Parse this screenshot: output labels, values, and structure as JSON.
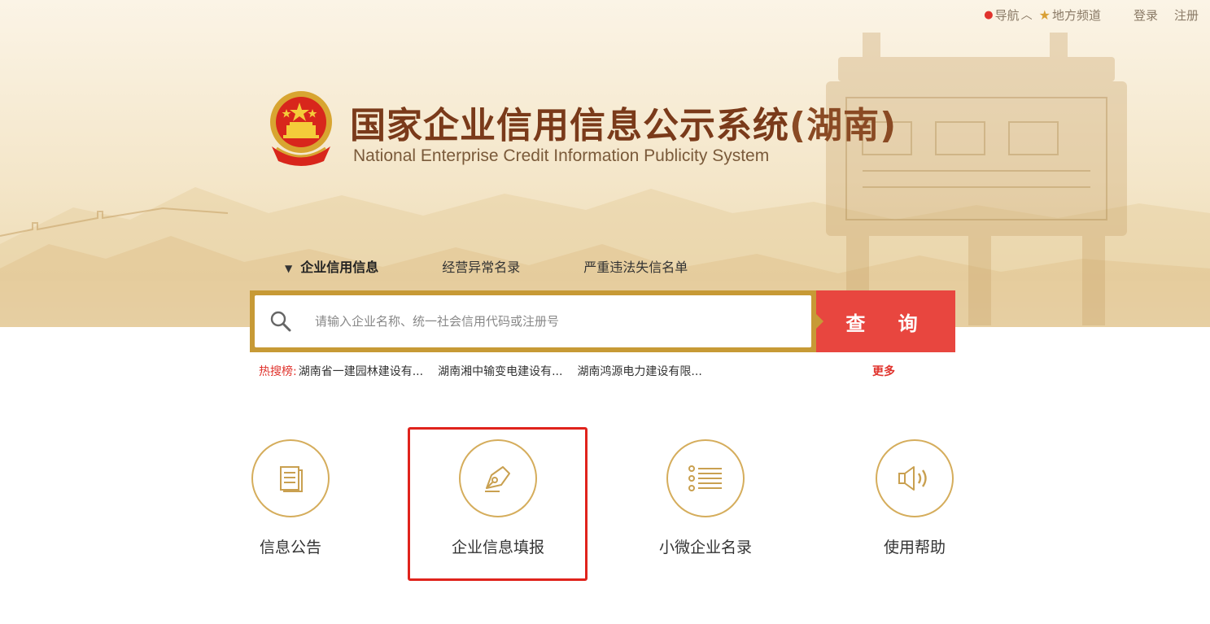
{
  "topnav": {
    "navigation_label": "导航",
    "local_channel_label": "地方频道",
    "login_label": "登录",
    "register_label": "注册"
  },
  "header": {
    "title_cn": "国家企业信用信息公示系统",
    "title_region": "(湖南)",
    "title_en": "National Enterprise Credit Information Publicity System"
  },
  "search": {
    "tabs": [
      {
        "label": "企业信用信息",
        "active": true
      },
      {
        "label": "经营异常名录",
        "active": false
      },
      {
        "label": "严重违法失信名单",
        "active": false
      }
    ],
    "placeholder": "请输入企业名称、统一社会信用代码或注册号",
    "button_label": "查 询"
  },
  "hot_search": {
    "label": "热搜榜:",
    "items": [
      "湖南省一建园林建设有...",
      "湖南湘中输变电建设有...",
      "湖南鸿源电力建设有限..."
    ],
    "more_label": "更多"
  },
  "quick_links": [
    {
      "label": "信息公告",
      "icon": "document-icon"
    },
    {
      "label": "企业信息填报",
      "icon": "pen-icon",
      "highlighted": true
    },
    {
      "label": "小微企业名录",
      "icon": "list-icon"
    },
    {
      "label": "使用帮助",
      "icon": "speaker-icon"
    }
  ],
  "colors": {
    "brand_gold": "#c79a36",
    "search_red": "#e8463f",
    "title_brown": "#7a3a1a",
    "highlight_red": "#e0231c",
    "hot_red": "#e0332d"
  }
}
